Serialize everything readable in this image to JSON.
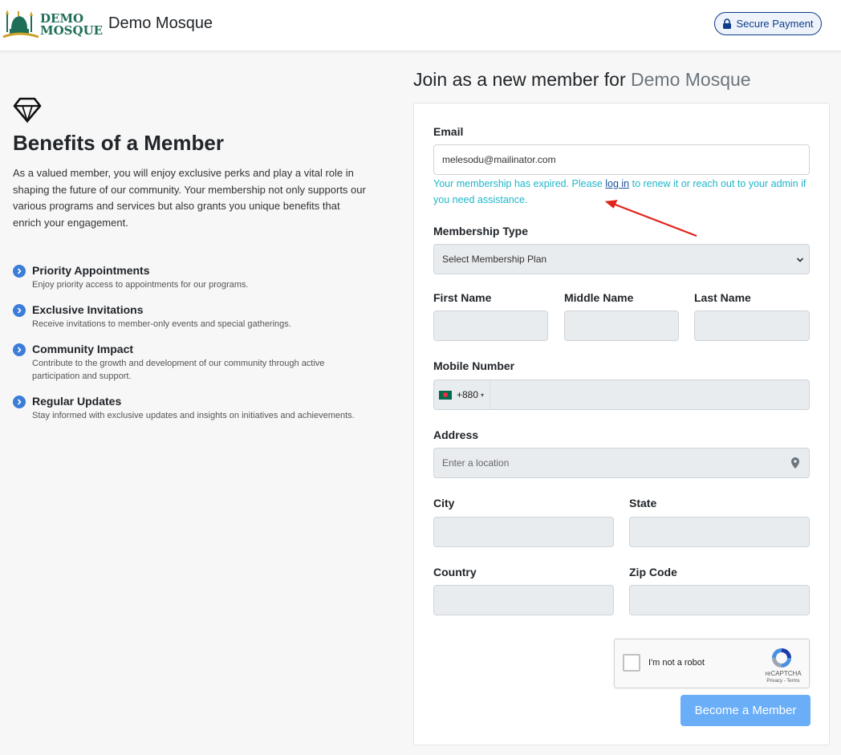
{
  "header": {
    "logo_line1": "DEMO",
    "logo_line2": "MOSQUE",
    "brand": "Demo Mosque",
    "secure_label": "Secure Payment"
  },
  "benefits": {
    "title": "Benefits of a Member",
    "description": "As a valued member, you will enjoy exclusive perks and play a vital role in shaping the future of our community. Your membership not only supports our various programs and services but also grants you unique benefits that enrich your engagement.",
    "items": [
      {
        "title": "Priority Appointments",
        "desc": "Enjoy priority access to appointments for our programs."
      },
      {
        "title": "Exclusive Invitations",
        "desc": "Receive invitations to member-only events and special gatherings."
      },
      {
        "title": "Community Impact",
        "desc": "Contribute to the growth and development of our community through active participation and support."
      },
      {
        "title": "Regular Updates",
        "desc": "Stay informed with exclusive updates and insights on initiatives and achievements."
      }
    ]
  },
  "form": {
    "heading_prefix": "Join as a new member for",
    "heading_org": "Demo Mosque",
    "email_label": "Email",
    "email_value": "melesodu@mailinator.com",
    "expired_before": "Your membership has expired. Please ",
    "expired_link": "log in",
    "expired_after": " to renew it or reach out to your admin if you need assistance.",
    "membership_label": "Membership Type",
    "membership_value": "Select Membership Plan",
    "first_name_label": "First Name",
    "middle_name_label": "Middle Name",
    "last_name_label": "Last Name",
    "mobile_label": "Mobile Number",
    "dial_code": "+880",
    "address_label": "Address",
    "address_placeholder": "Enter a location",
    "city_label": "City",
    "state_label": "State",
    "country_label": "Country",
    "zip_label": "Zip Code",
    "captcha_text": "I'm not a robot",
    "captcha_brand": "reCAPTCHA",
    "captcha_links": "Privacy - Terms",
    "submit_label": "Become a Member"
  },
  "colors": {
    "accent": "#6aaef8",
    "expired_text": "#20b6c9",
    "feature_icon": "#3b7dd8",
    "annotation_arrow": "#e0231b"
  }
}
